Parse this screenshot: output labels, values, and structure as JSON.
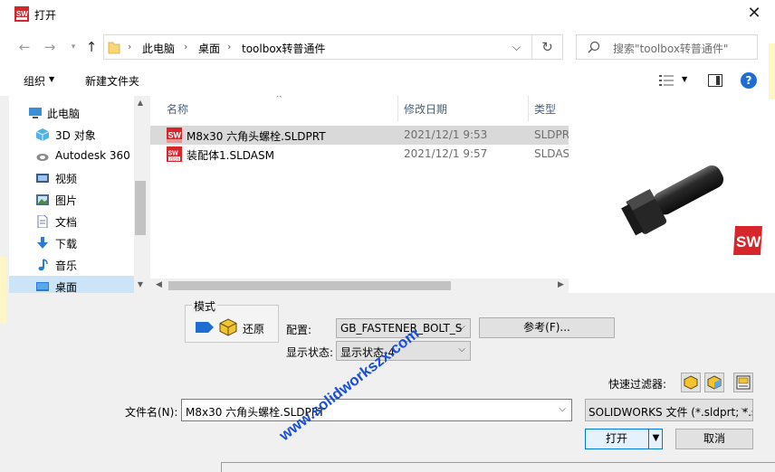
{
  "window": {
    "title": "打开",
    "icon": "solidworks-app-icon",
    "close_glyph": "✕"
  },
  "nav": {
    "back_glyph": "←",
    "forward_glyph": "→",
    "dropdown_glyph": "▾",
    "up_glyph": "↑",
    "breadcrumbs": [
      "此电脑",
      "桌面",
      "toolbox转普通件"
    ],
    "crumb_separator": "›",
    "address_dropdown_glyph": "⌵",
    "refresh_glyph": "↻",
    "search_placeholder": "搜索\"toolbox转普通件\""
  },
  "toolbar": {
    "organize_label": "组织",
    "organize_arrow": "▼",
    "new_folder_label": "新建文件夹",
    "view_arrow": "▼",
    "help_label": "?"
  },
  "sidebar": {
    "items": [
      {
        "label": "此电脑",
        "icon": "computer-icon",
        "selected": false
      },
      {
        "label": "3D 对象",
        "icon": "cube-3d-icon",
        "selected": false
      },
      {
        "label": "Autodesk 360",
        "icon": "cloud-icon",
        "selected": false
      },
      {
        "label": "视频",
        "icon": "video-icon",
        "selected": false
      },
      {
        "label": "图片",
        "icon": "picture-icon",
        "selected": false
      },
      {
        "label": "文档",
        "icon": "document-icon",
        "selected": false
      },
      {
        "label": "下载",
        "icon": "download-icon",
        "selected": false
      },
      {
        "label": "音乐",
        "icon": "music-icon",
        "selected": false
      },
      {
        "label": "桌面",
        "icon": "desktop-icon",
        "selected": true
      }
    ],
    "scroll_up": "▲",
    "scroll_down": "▼"
  },
  "filelist": {
    "columns": [
      "名称",
      "修改日期",
      "类型"
    ],
    "sort_glyph": "^",
    "rows": [
      {
        "name": "M8x30 六角头螺栓.SLDPRT",
        "date": "2021/12/1 9:53",
        "type": "SLDPRT",
        "icon": "sw-part-icon",
        "selected": true
      },
      {
        "name": "装配体1.SLDASM",
        "date": "2021/12/1 9:57",
        "type": "SLDASM",
        "icon": "sw-assembly-icon",
        "selected": false
      }
    ],
    "scroll_left": "◀",
    "scroll_right": "▶"
  },
  "preview": {
    "image": "hex-bolt-preview",
    "logo": "solidworks-logo-icon"
  },
  "options": {
    "mode_label": "模式",
    "restore_label": "还原",
    "config_label": "配置:",
    "config_value": "GB_FASTENER_BOLT_S",
    "display_state_label": "显示状态:",
    "display_state_value": "显示状态-4",
    "reference_button": "参考(F)...",
    "quick_filter_label": "快速过滤器:",
    "combo_arrow": "⌵"
  },
  "bottom": {
    "filename_label": "文件名(N):",
    "filename_value": "M8x30 六角头螺栓.SLDPRT",
    "filetype_value": "SOLIDWORKS 文件 (*.sldprt; *.sldasm; *.slddrw)",
    "open_button": "打开",
    "open_split_glyph": "▼",
    "cancel_button": "取消"
  },
  "watermark": {
    "text": "www.solidworkszx.com",
    "color": "#1a4fd6"
  },
  "colors": {
    "selection": "#cce4f7",
    "row_selected": "#d9d9d9",
    "accent": "#0078d7",
    "sw_red": "#d6262b"
  }
}
